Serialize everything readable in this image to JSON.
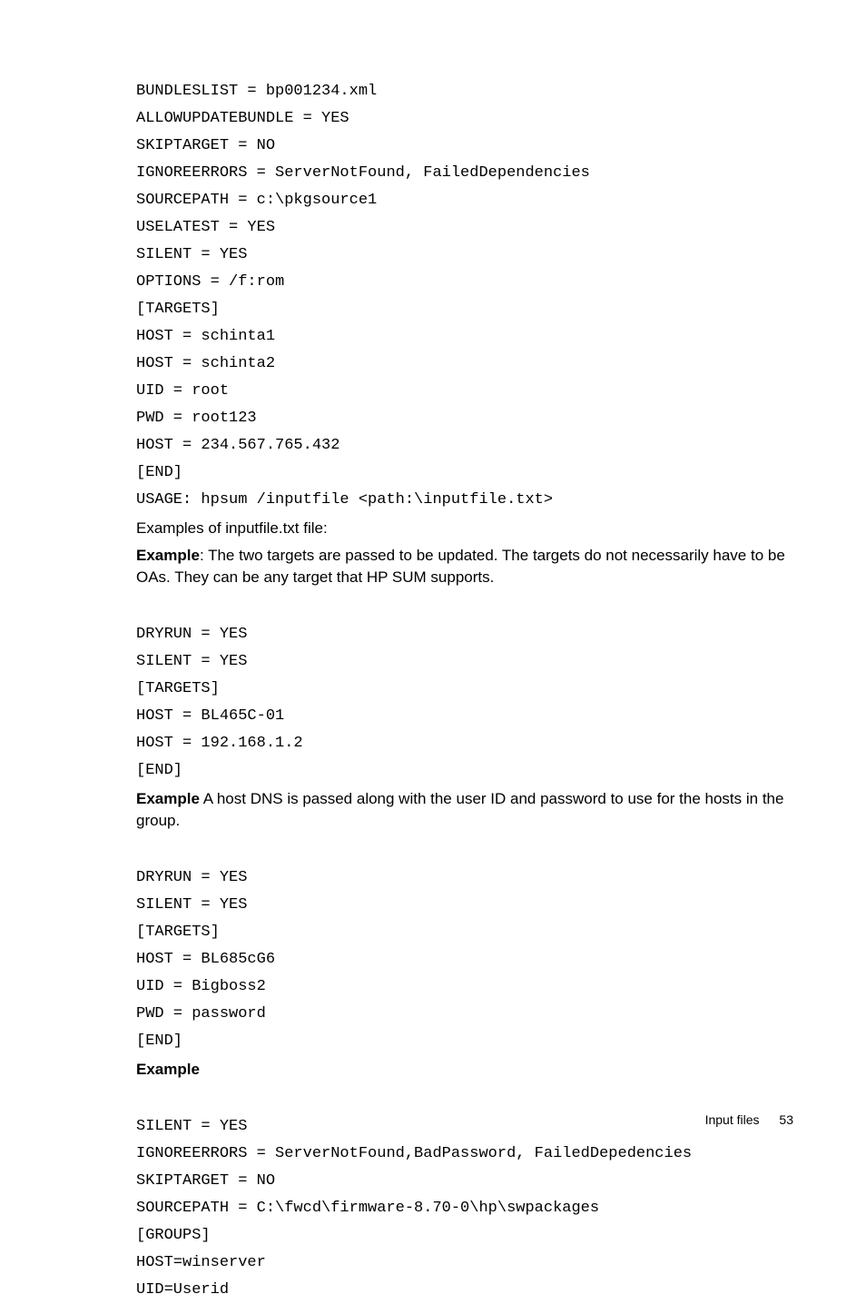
{
  "code1": {
    "l1": "BUNDLESLIST = bp001234.xml",
    "l2": "ALLOWUPDATEBUNDLE = YES",
    "l3": "SKIPTARGET = NO",
    "l4": "IGNOREERRORS = ServerNotFound, FailedDependencies",
    "l5": "SOURCEPATH = c:\\pkgsource1",
    "l6": "USELATEST = YES",
    "l7": "SILENT = YES",
    "l8": "OPTIONS = /f:rom",
    "l9": "[TARGETS]",
    "l10": "HOST = schinta1",
    "l11": "HOST = schinta2",
    "l12": "UID = root",
    "l13": "PWD = root123",
    "l14": "HOST = 234.567.765.432",
    "l15": "[END]",
    "l16": "USAGE: hpsum /inputfile <path:\\inputfile.txt>"
  },
  "para1": "Examples of inputfile.txt file:",
  "example_label": "Example",
  "para2a": ": The two targets are passed to be updated. The targets do not necessarily have to be OAs. They can be any target that HP SUM supports.",
  "code2": {
    "l1": "DRYRUN = YES",
    "l2": "SILENT = YES",
    "l3": "[TARGETS]",
    "l4": "HOST = BL465C-01",
    "l5": "HOST = 192.168.1.2",
    "l6": "[END]"
  },
  "para3a": " A host DNS is passed along with the user ID and password to use for the hosts in the group.",
  "code3": {
    "l1": "DRYRUN = YES",
    "l2": "SILENT = YES",
    "l3": "[TARGETS]",
    "l4": "HOST = BL685cG6",
    "l5": "UID = Bigboss2",
    "l6": "PWD = password",
    "l7": "[END]"
  },
  "code4": {
    "l1": "SILENT = YES",
    "l2": "IGNOREERRORS = ServerNotFound,BadPassword, FailedDepedencies",
    "l3": "SKIPTARGET = NO",
    "l4": "SOURCEPATH = C:\\fwcd\\firmware-8.70-0\\hp\\swpackages",
    "l5": "[GROUPS]",
    "l6": "HOST=winserver",
    "l7": "UID=Userid"
  },
  "footer_text": "Input files",
  "page_number": "53"
}
